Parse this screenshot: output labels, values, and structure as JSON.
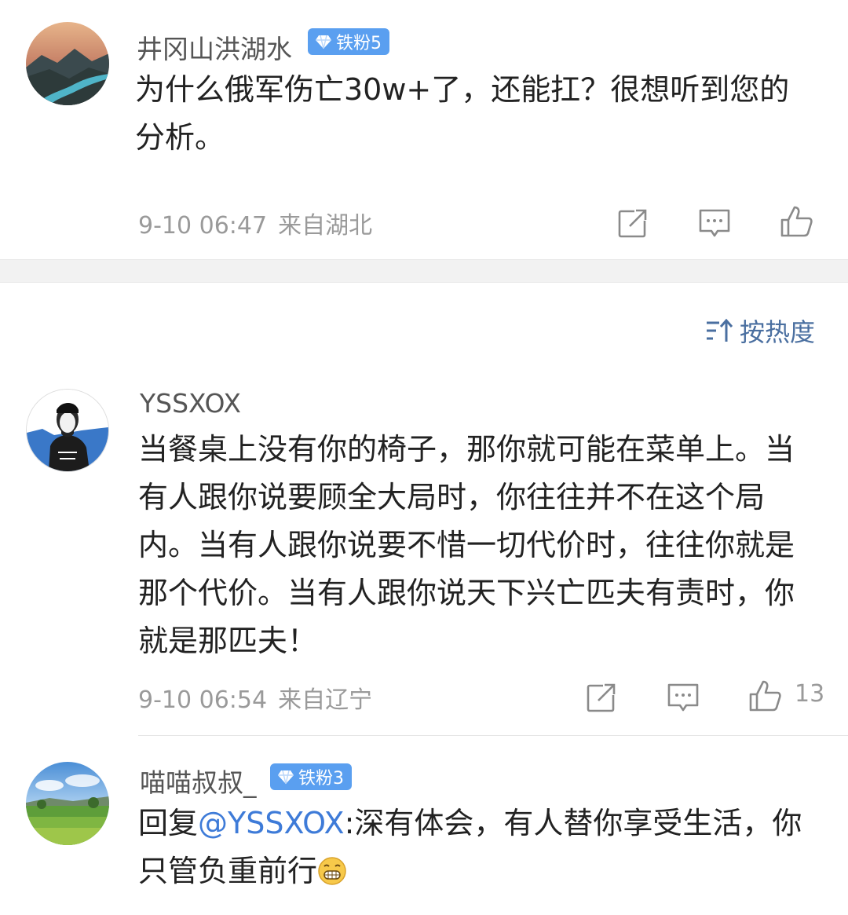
{
  "post": {
    "username": "井冈山洪湖水",
    "badge": "铁粉5",
    "text": "为什么俄军伤亡30w+了，还能扛？很想听到您的分析。",
    "time": "9-10 06:47",
    "location": "来自湖北",
    "actions": [
      "share-icon",
      "comment-icon",
      "like-icon"
    ]
  },
  "sort": {
    "label": "按热度",
    "icon": "sort-icon"
  },
  "comments": [
    {
      "username": "YSSXOX",
      "text": "当餐桌上没有你的椅子，那你就可能在菜单上。当有人跟你说要顾全大局时，你往往并不在这个局内。当有人跟你说要不惜一切代价时，往往你就是那个代价。当有人跟你说天下兴亡匹夫有责时，你就是那匹夫！",
      "time": "9-10 06:54",
      "location": "来自辽宁",
      "likes": "13"
    },
    {
      "username": "喵喵叔叔_",
      "badge": "铁粉3",
      "reply_prefix": "回复",
      "mention": "@YSSXOX",
      "text": ":深有体会，有人替你享受生活，你只管负重前行",
      "emoji": "grin-emoji"
    }
  ],
  "colors": {
    "accent": "#4a6fa0",
    "badge": "#5a9ff0",
    "mention": "#3e7bd8"
  }
}
